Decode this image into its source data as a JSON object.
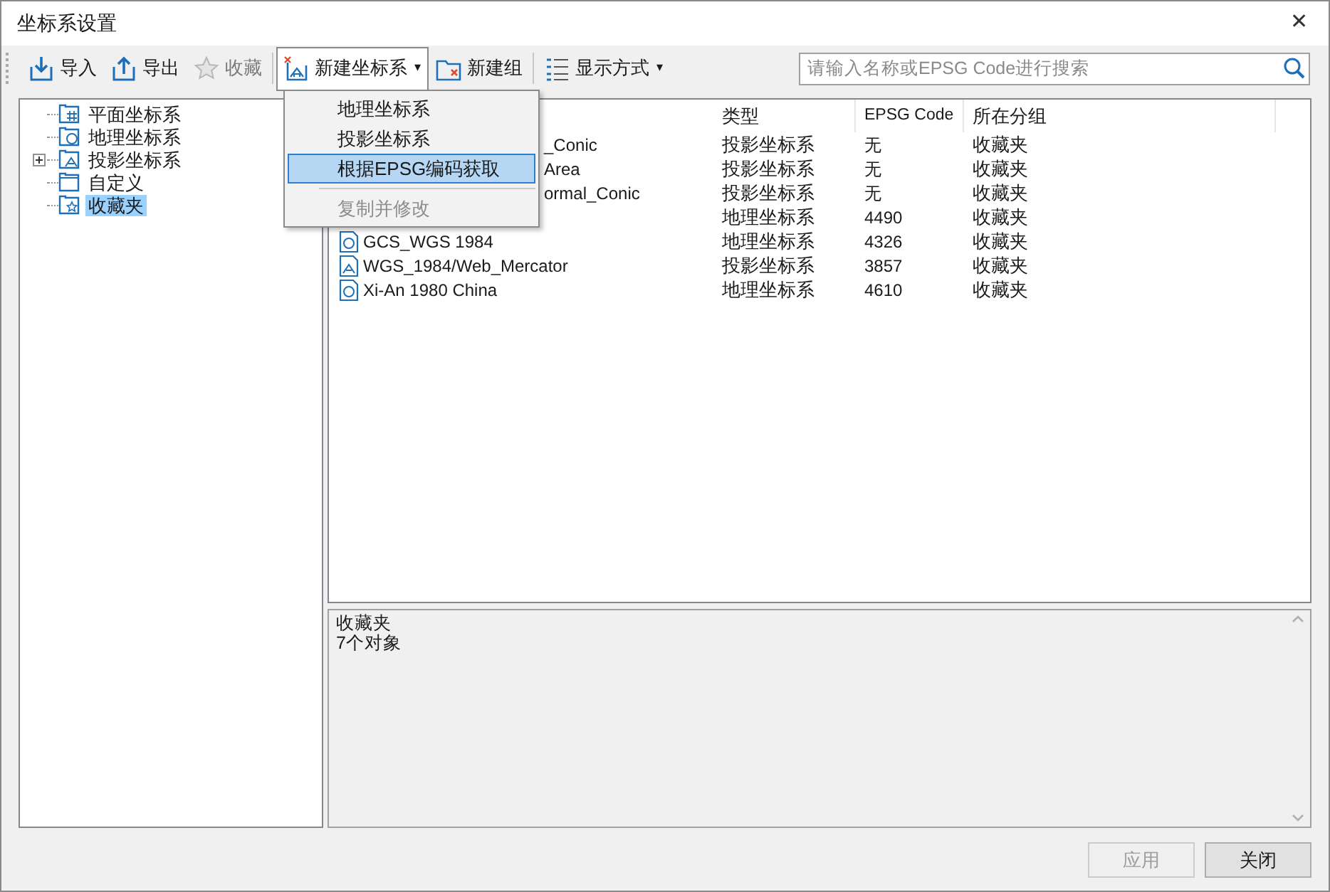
{
  "window": {
    "title": "坐标系设置",
    "close": "✕"
  },
  "toolbar": [
    {
      "label": "导入",
      "disabled": false
    },
    {
      "label": "导出",
      "disabled": false
    },
    {
      "label": "收藏",
      "disabled": true
    },
    {
      "label": "新建坐标系",
      "disabled": false,
      "expanded": true,
      "caret": "▾"
    },
    {
      "label": "新建组",
      "disabled": false
    },
    {
      "label": "显示方式",
      "disabled": false,
      "caret": "▾"
    }
  ],
  "search": {
    "placeholder": "请输入名称或EPSG Code进行搜索"
  },
  "menu": [
    {
      "label": "地理坐标系",
      "selected": false,
      "disabled": false
    },
    {
      "label": "投影坐标系",
      "selected": false,
      "disabled": false
    },
    {
      "label": "根据EPSG编码获取",
      "selected": true,
      "disabled": false
    },
    {
      "label": "复制并修改",
      "selected": false,
      "disabled": true
    }
  ],
  "tree": [
    {
      "label": "平面坐标系",
      "selected": false
    },
    {
      "label": "地理坐标系",
      "selected": false
    },
    {
      "label": "投影坐标系",
      "selected": false,
      "expanded": false
    },
    {
      "label": "自定义",
      "selected": false
    },
    {
      "label": "收藏夹",
      "selected": true
    }
  ],
  "table": {
    "columns": [
      "类型",
      "EPSG Code",
      "所在分组"
    ],
    "rows": [
      {
        "name": "_Conic",
        "type": "投影坐标系",
        "epsg": "无",
        "group": "收藏夹"
      },
      {
        "name": "Area",
        "type": "投影坐标系",
        "epsg": "无",
        "group": "收藏夹"
      },
      {
        "name": "ormal_Conic",
        "type": "投影坐标系",
        "epsg": "无",
        "group": "收藏夹"
      },
      {
        "type": "地理坐标系",
        "epsg": "4490",
        "group": "收藏夹"
      },
      {
        "kind": "geographic",
        "name": "GCS_WGS 1984",
        "type": "地理坐标系",
        "epsg": "4326",
        "group": "收藏夹"
      },
      {
        "kind": "projected",
        "name": "WGS_1984/Web_Mercator",
        "type": "投影坐标系",
        "epsg": "3857",
        "group": "收藏夹"
      },
      {
        "kind": "geographic",
        "name": "Xi-An 1980 China",
        "type": "地理坐标系",
        "epsg": "4610",
        "group": "收藏夹"
      }
    ]
  },
  "info": [
    "收藏夹",
    "7个对象"
  ],
  "buttons": [
    {
      "label": "应用",
      "disabled": true
    },
    {
      "label": "关闭",
      "disabled": false
    }
  ]
}
